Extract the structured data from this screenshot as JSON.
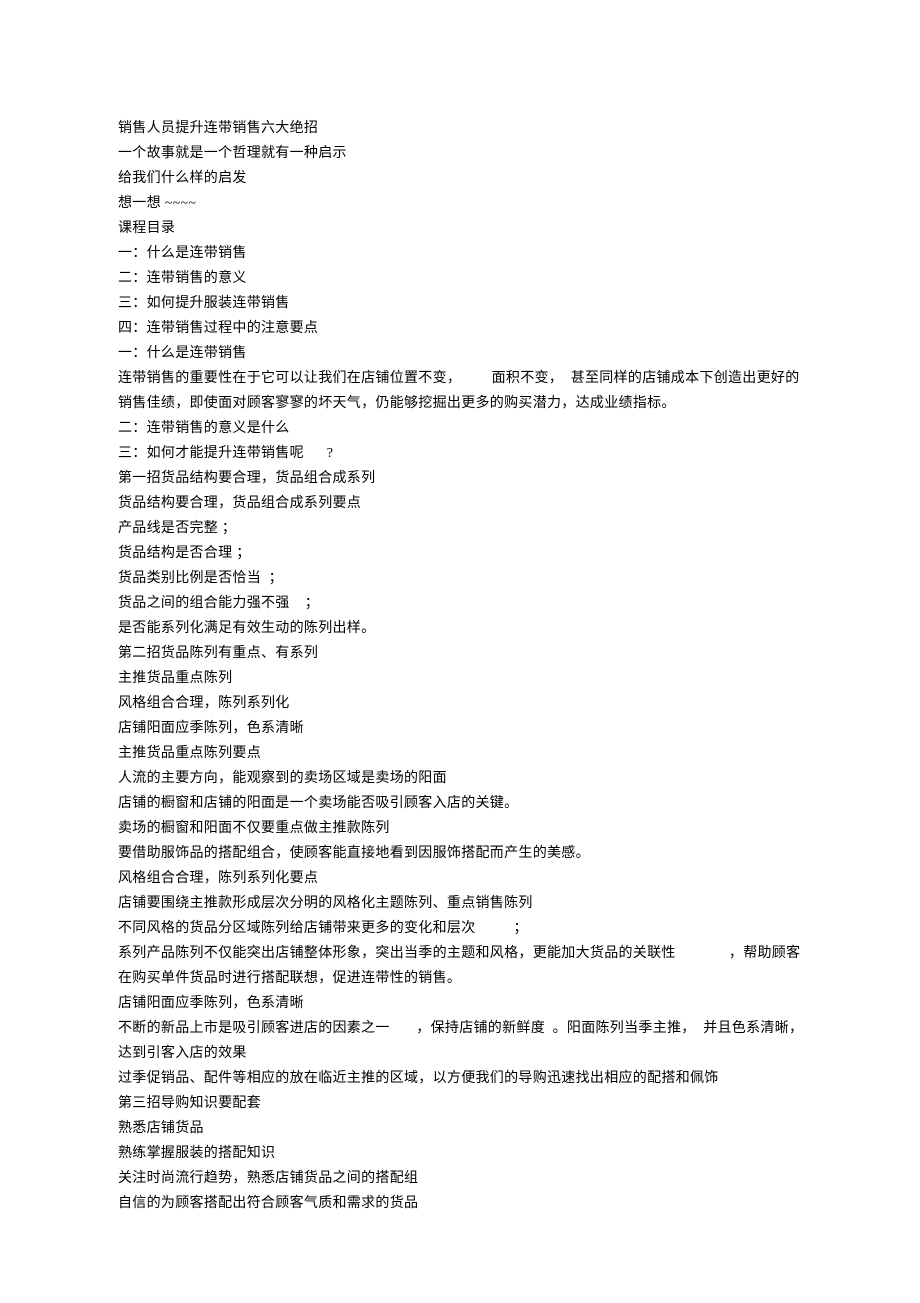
{
  "lines": [
    "销售人员提升连带销售六大绝招",
    "一个故事就是一个哲理就有一种启示",
    "给我们什么样的启发",
    "想一想 ~~~~",
    "课程目录",
    "一：什么是连带销售",
    "二：连带销售的意义",
    "三：如何提升服装连带销售",
    "四：连带销售过程中的注意要点",
    "一：什么是连带销售",
    "连带销售的重要性在于它可以让我们在店铺位置不变，        面积不变，  甚至同样的店铺成本下创造出更好的",
    "销售佳绩，即使面对顾客寥寥的坏天气，仍能够挖掘出更多的购买潜力，达成业绩指标。",
    "二：连带销售的意义是什么",
    "三：如何才能提升连带销售呢      ?",
    "第一招货品结构要合理，货品组合成系列",
    "货品结构要合理，货品组合成系列要点",
    "产品线是否完整 ；",
    "货品结构是否合理 ；",
    "货品类别比例是否恰当  ；",
    "货品之间的组合能力强不强    ；",
    "是否能系列化满足有效生动的陈列出样。",
    "第二招货品陈列有重点、有系列",
    "主推货品重点陈列",
    "风格组合合理，陈列系列化",
    "店铺阳面应季陈列，色系清晰",
    "主推货品重点陈列要点",
    "人流的主要方向，能观察到的卖场区域是卖场的阳面",
    "店铺的橱窗和店铺的阳面是一个卖场能否吸引顾客入店的关键。",
    "卖场的橱窗和阳面不仅要重点做主推款陈列",
    "要借助服饰品的搭配组合，使顾客能直接地看到因服饰搭配而产生的美感。",
    "风格组合合理，陈列系列化要点",
    "店铺要围绕主推款形成层次分明的风格化主题陈列、重点销售陈列",
    "不同风格的货品分区域陈列给店铺带来更多的变化和层次          ；",
    "系列产品陈列不仅能突出店铺整体形象，突出当季的主题和风格，更能加大货品的关联性              ，帮助顾客",
    "在购买单件货品时进行搭配联想，促进连带性的销售。",
    "店铺阳面应季陈列，色系清晰",
    "不断的新品上市是吸引顾客进店的因素之一       ，保持店铺的新鲜度  。阳面陈列当季主推，  并且色系清晰，",
    "达到引客入店的效果",
    "过季促销品、配件等相应的放在临近主推的区域，以方便我们的导购迅速找出相应的配搭和佩饰",
    "第三招导购知识要配套",
    "熟悉店铺货品",
    "熟练掌握服装的搭配知识",
    "关注时尚流行趋势，熟悉店铺货品之间的搭配组",
    "自信的为顾客搭配出符合顾客气质和需求的货品"
  ]
}
